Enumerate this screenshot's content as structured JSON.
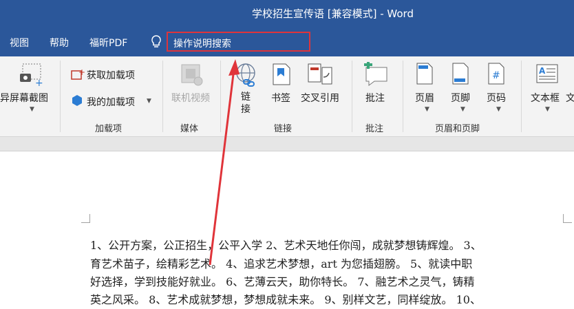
{
  "window": {
    "title": "学校招生宣传语 [兼容模式] - Word"
  },
  "menu": {
    "items": [
      "视图",
      "帮助",
      "福昕PDF"
    ],
    "search_label": "操作说明搜索"
  },
  "ribbon": {
    "screenshot_label": "屏幕截图",
    "get_addins": "获取加载项",
    "my_addins": "我的加载项",
    "online_video": "联机视频",
    "link": "链接",
    "bookmark": "书签",
    "cross_ref": "交叉引用",
    "comment": "批注",
    "header": "页眉",
    "footer": "页脚",
    "page_number": "页码",
    "textbox": "文本框",
    "groups": {
      "addins": "加载项",
      "media": "媒体",
      "links": "链接",
      "comments": "批注",
      "header_footer": "页眉和页脚"
    }
  },
  "document": {
    "lines": [
      "1、公开方案，公正招生，公平入学  2、艺术天地任你闯，成就梦想铸辉煌。 3、",
      "育艺术苗子，绘精彩艺术。 4、追求艺术梦想，art 为您插翅膀。 5、就读中职",
      "好选择，学到技能好就业。 6、艺薄云天，助你特长。 7、融艺术之灵气，铸精",
      "英之风采。 8、艺术成就梦想，梦想成就未来。 9、别样文艺，同样绽放。 10、"
    ]
  },
  "colors": {
    "title_bar": "#2b579a",
    "highlight": "#e0343a",
    "ribbon_bg": "#f3f3f3"
  }
}
